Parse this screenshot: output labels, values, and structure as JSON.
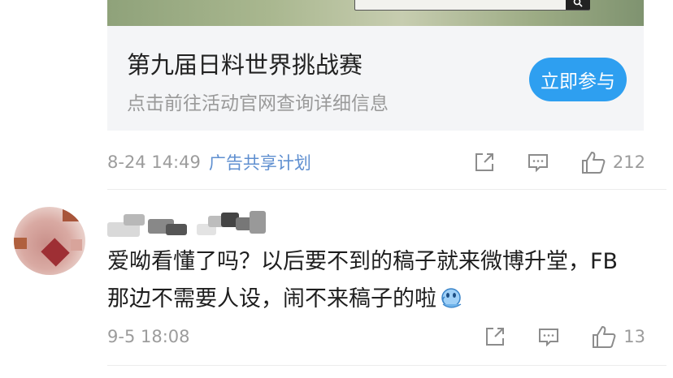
{
  "ad": {
    "title": "第九届日料世界挑战赛",
    "subtitle": "点击前往活动官网查询详细信息",
    "button_label": "立即参与"
  },
  "post_meta": {
    "time": "8-24 14:49",
    "tag": "广告共享计划",
    "like_count": "212"
  },
  "comment": {
    "text": "爱呦看懂了吗？以后要不到的稿子就来微博升堂，FB那边不需要人设，闹不来稿子的啦",
    "time": "9-5 18:08",
    "like_count": "13"
  },
  "icons": {
    "share": "share-icon",
    "comment": "comment-icon",
    "like": "like-icon",
    "search": "search-icon"
  },
  "colors": {
    "accent_button": "#2e9ff0",
    "link_blue": "#5f8fd0",
    "muted_text": "#9c9c9c"
  }
}
